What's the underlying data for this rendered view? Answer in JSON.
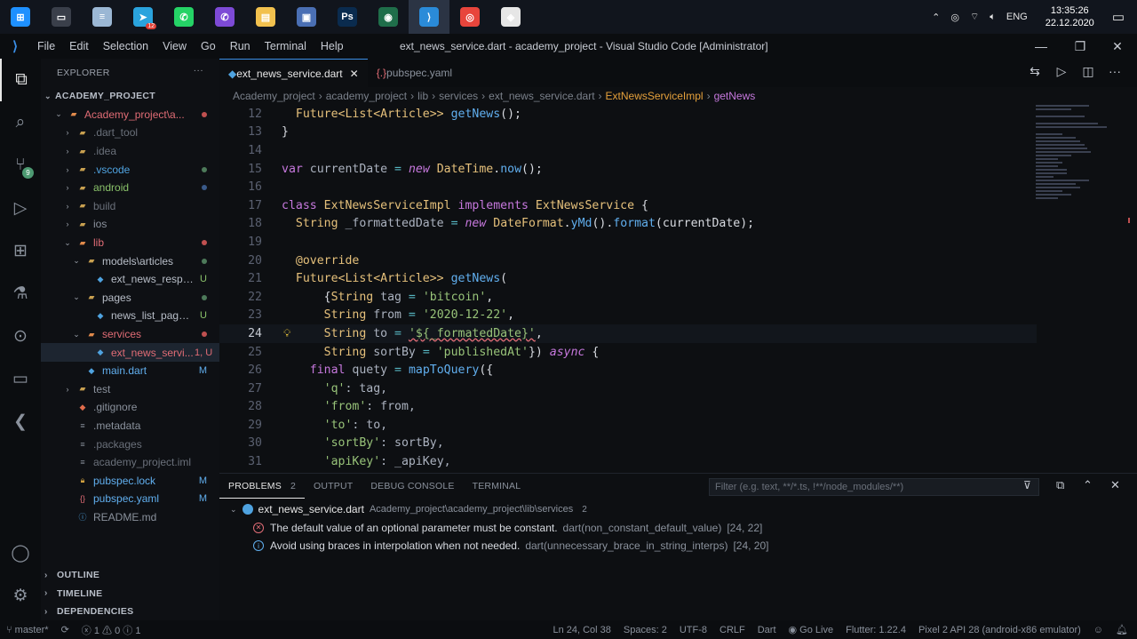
{
  "taskbar": {
    "apps": [
      {
        "name": "windows-start-icon",
        "color": "#1e90ff",
        "glyph": "⊞"
      },
      {
        "name": "task-view-icon",
        "color": "#3a3f4a",
        "glyph": "▭"
      },
      {
        "name": "notepad-icon",
        "color": "#9bb7d4",
        "glyph": "≡"
      },
      {
        "name": "telegram-icon",
        "color": "#2aa3dd",
        "glyph": "➤",
        "badge": "12"
      },
      {
        "name": "whatsapp-icon",
        "color": "#25d366",
        "glyph": "✆"
      },
      {
        "name": "viber-icon",
        "color": "#7d4ad6",
        "glyph": "✆"
      },
      {
        "name": "file-explorer-icon",
        "color": "#f2c14e",
        "glyph": "▤"
      },
      {
        "name": "save-icon",
        "color": "#4a6fb4",
        "glyph": "▣"
      },
      {
        "name": "photoshop-icon",
        "color": "#0a2b4e",
        "glyph": "Ps"
      },
      {
        "name": "android-studio-icon",
        "color": "#1f6e4a",
        "glyph": "◉"
      },
      {
        "name": "vscode-icon",
        "color": "#2a8bd9",
        "glyph": "⟩",
        "active": true
      },
      {
        "name": "chrome-icon",
        "color": "#e8453c",
        "glyph": "◎"
      },
      {
        "name": "app-icon",
        "color": "#e6e6e6",
        "glyph": "◈"
      }
    ],
    "tray": {
      "lang": "ENG",
      "time": "13:35:26",
      "date": "22.12.2020"
    }
  },
  "titlebar": {
    "menu": [
      "File",
      "Edit",
      "Selection",
      "View",
      "Go",
      "Run",
      "Terminal",
      "Help"
    ],
    "title": "ext_news_service.dart - academy_project - Visual Studio Code [Administrator]"
  },
  "activity": {
    "scm_badge": "9"
  },
  "explorer": {
    "title": "EXPLORER",
    "root": "ACADEMY_PROJECT",
    "tree": [
      {
        "indent": 1,
        "chev": "⌄",
        "label": "Academy_project\\a...",
        "icon": "folder",
        "color": "#e06c75",
        "deco": "dot",
        "decoColor": "#c05050"
      },
      {
        "indent": 2,
        "chev": "›",
        "label": ".dart_tool",
        "icon": "folder",
        "color": "#6a707a",
        "deco": "",
        "decoColor": ""
      },
      {
        "indent": 2,
        "chev": "›",
        "label": ".idea",
        "icon": "folder",
        "color": "#6a707a",
        "deco": "",
        "decoColor": ""
      },
      {
        "indent": 2,
        "chev": "›",
        "label": ".vscode",
        "icon": "folder",
        "color": "#4fa3e0",
        "deco": "dot",
        "decoColor": "#4d7a5a"
      },
      {
        "indent": 2,
        "chev": "›",
        "label": "android",
        "icon": "folder",
        "color": "#8ac26a",
        "deco": "dot",
        "decoColor": "#3a5a8a"
      },
      {
        "indent": 2,
        "chev": "›",
        "label": "build",
        "icon": "folder",
        "color": "#6a707a",
        "deco": "",
        "decoColor": ""
      },
      {
        "indent": 2,
        "chev": "›",
        "label": "ios",
        "icon": "folder",
        "color": "#8a919c",
        "deco": "",
        "decoColor": ""
      },
      {
        "indent": 2,
        "chev": "⌄",
        "label": "lib",
        "icon": "folder",
        "color": "#e06c75",
        "deco": "dot",
        "decoColor": "#c05050"
      },
      {
        "indent": 3,
        "chev": "⌄",
        "label": "models\\articles",
        "icon": "folder",
        "color": "#b8bec8",
        "deco": "dot",
        "decoColor": "#4d7a5a"
      },
      {
        "indent": 4,
        "chev": "",
        "label": "ext_news_respo...",
        "icon": "dart",
        "color": "#b8bec8",
        "deco": "U",
        "decoColor": "#8ac26a"
      },
      {
        "indent": 3,
        "chev": "⌄",
        "label": "pages",
        "icon": "folder",
        "color": "#b8bec8",
        "deco": "dot",
        "decoColor": "#4d7a5a"
      },
      {
        "indent": 4,
        "chev": "",
        "label": "news_list_page.d...",
        "icon": "dart",
        "color": "#b8bec8",
        "deco": "U",
        "decoColor": "#8ac26a"
      },
      {
        "indent": 3,
        "chev": "⌄",
        "label": "services",
        "icon": "folder",
        "color": "#e06c75",
        "deco": "dot",
        "decoColor": "#c05050"
      },
      {
        "indent": 4,
        "chev": "",
        "label": "ext_news_servi...",
        "icon": "dart",
        "color": "#e06c75",
        "deco": "1, U",
        "decoColor": "#e06c75",
        "selected": true
      },
      {
        "indent": 3,
        "chev": "",
        "label": "main.dart",
        "icon": "dart",
        "color": "#61afef",
        "deco": "M",
        "decoColor": "#61afef"
      },
      {
        "indent": 2,
        "chev": "›",
        "label": "test",
        "icon": "folder",
        "color": "#8a919c",
        "deco": "",
        "decoColor": ""
      },
      {
        "indent": 2,
        "chev": "",
        "label": ".gitignore",
        "icon": "git",
        "color": "#8a919c",
        "deco": "",
        "decoColor": ""
      },
      {
        "indent": 2,
        "chev": "",
        "label": ".metadata",
        "icon": "file",
        "color": "#8a919c",
        "deco": "",
        "decoColor": ""
      },
      {
        "indent": 2,
        "chev": "",
        "label": ".packages",
        "icon": "file",
        "color": "#6a707a",
        "deco": "",
        "decoColor": ""
      },
      {
        "indent": 2,
        "chev": "",
        "label": "academy_project.iml",
        "icon": "file",
        "color": "#6a707a",
        "deco": "",
        "decoColor": ""
      },
      {
        "indent": 2,
        "chev": "",
        "label": "pubspec.lock",
        "icon": "lock",
        "color": "#61afef",
        "deco": "M",
        "decoColor": "#61afef"
      },
      {
        "indent": 2,
        "chev": "",
        "label": "pubspec.yaml",
        "icon": "yaml",
        "color": "#61afef",
        "deco": "M",
        "decoColor": "#61afef"
      },
      {
        "indent": 2,
        "chev": "",
        "label": "README.md",
        "icon": "md",
        "color": "#8a919c",
        "deco": "",
        "decoColor": ""
      }
    ],
    "sections": [
      "OUTLINE",
      "TIMELINE",
      "DEPENDENCIES"
    ]
  },
  "tabs": [
    {
      "label": "ext_news_service.dart",
      "active": true,
      "icon": "dart"
    },
    {
      "label": "pubspec.yaml",
      "active": false,
      "icon": "yaml"
    }
  ],
  "breadcrumb": [
    "Academy_project",
    "academy_project",
    "lib",
    "services",
    "ext_news_service.dart",
    "ExtNewsServiceImpl",
    "getNews"
  ],
  "code": [
    {
      "n": "12",
      "t": [
        [
          "  ",
          "id"
        ],
        [
          "Future<List<Article>>",
          "ty"
        ],
        [
          " ",
          "id"
        ],
        [
          "getNews",
          "fn"
        ],
        [
          "();",
          "pm"
        ]
      ]
    },
    {
      "n": "13",
      "t": [
        [
          "}",
          "pm"
        ]
      ]
    },
    {
      "n": "14",
      "t": []
    },
    {
      "n": "15",
      "t": [
        [
          "var",
          "kw"
        ],
        [
          " currentDate ",
          "id"
        ],
        [
          "=",
          "op"
        ],
        [
          " ",
          "id"
        ],
        [
          "new",
          "kw it"
        ],
        [
          " ",
          "id"
        ],
        [
          "DateTime",
          "ty"
        ],
        [
          ".",
          "pm"
        ],
        [
          "now",
          "fn"
        ],
        [
          "();",
          "pm"
        ]
      ]
    },
    {
      "n": "16",
      "t": []
    },
    {
      "n": "17",
      "t": [
        [
          "class",
          "kw"
        ],
        [
          " ",
          "id"
        ],
        [
          "ExtNewsServiceImpl",
          "ty"
        ],
        [
          " ",
          "id"
        ],
        [
          "implements",
          "kw"
        ],
        [
          " ",
          "id"
        ],
        [
          "ExtNewsService",
          "ty"
        ],
        [
          " {",
          "pm"
        ]
      ]
    },
    {
      "n": "18",
      "t": [
        [
          "  ",
          "id"
        ],
        [
          "String",
          "ty"
        ],
        [
          " _formattedDate ",
          "id"
        ],
        [
          "=",
          "op"
        ],
        [
          " ",
          "id"
        ],
        [
          "new",
          "kw it"
        ],
        [
          " ",
          "id"
        ],
        [
          "DateFormat",
          "ty"
        ],
        [
          ".",
          "pm"
        ],
        [
          "yMd",
          "fn"
        ],
        [
          "().",
          "pm"
        ],
        [
          "format",
          "fn"
        ],
        [
          "(currentDate);",
          "pm"
        ]
      ]
    },
    {
      "n": "19",
      "t": []
    },
    {
      "n": "20",
      "t": [
        [
          "  ",
          "id"
        ],
        [
          "@override",
          "anno"
        ]
      ]
    },
    {
      "n": "21",
      "t": [
        [
          "  ",
          "id"
        ],
        [
          "Future<List<Article>>",
          "ty"
        ],
        [
          " ",
          "id"
        ],
        [
          "getNews",
          "fn"
        ],
        [
          "(",
          "pm"
        ]
      ]
    },
    {
      "n": "22",
      "t": [
        [
          "      {",
          "pm"
        ],
        [
          "String",
          "ty"
        ],
        [
          " tag ",
          "id"
        ],
        [
          "=",
          "op"
        ],
        [
          " ",
          "id"
        ],
        [
          "'bitcoin'",
          "st"
        ],
        [
          ",",
          "pm"
        ]
      ]
    },
    {
      "n": "23",
      "t": [
        [
          "      ",
          "id"
        ],
        [
          "String",
          "ty"
        ],
        [
          " from ",
          "id"
        ],
        [
          "=",
          "op"
        ],
        [
          " ",
          "id"
        ],
        [
          "'2020-12-22'",
          "st"
        ],
        [
          ",",
          "pm"
        ]
      ]
    },
    {
      "n": "24",
      "t": [
        [
          "      ",
          "id"
        ],
        [
          "String",
          "ty"
        ],
        [
          " to ",
          "id"
        ],
        [
          "=",
          "op"
        ],
        [
          " ",
          "id"
        ],
        [
          "'${_formatedDate}'",
          "st"
        ],
        [
          ",",
          "pm"
        ]
      ],
      "current": true,
      "bulb": true
    },
    {
      "n": "25",
      "t": [
        [
          "      ",
          "id"
        ],
        [
          "String",
          "ty"
        ],
        [
          " sortBy ",
          "id"
        ],
        [
          "=",
          "op"
        ],
        [
          " ",
          "id"
        ],
        [
          "'publishedAt'",
          "st"
        ],
        [
          "}) ",
          "pm"
        ],
        [
          "async",
          "kw it"
        ],
        [
          " {",
          "pm"
        ]
      ]
    },
    {
      "n": "26",
      "t": [
        [
          "    ",
          "id"
        ],
        [
          "final",
          "kw"
        ],
        [
          " quety ",
          "id"
        ],
        [
          "=",
          "op"
        ],
        [
          " ",
          "id"
        ],
        [
          "mapToQuery",
          "fn"
        ],
        [
          "({",
          "pm"
        ]
      ]
    },
    {
      "n": "27",
      "t": [
        [
          "      ",
          "id"
        ],
        [
          "'q'",
          "st"
        ],
        [
          ": tag,",
          "id"
        ]
      ]
    },
    {
      "n": "28",
      "t": [
        [
          "      ",
          "id"
        ],
        [
          "'from'",
          "st"
        ],
        [
          ": from,",
          "id"
        ]
      ]
    },
    {
      "n": "29",
      "t": [
        [
          "      ",
          "id"
        ],
        [
          "'to'",
          "st"
        ],
        [
          ": to,",
          "id"
        ]
      ]
    },
    {
      "n": "30",
      "t": [
        [
          "      ",
          "id"
        ],
        [
          "'sortBy'",
          "st"
        ],
        [
          ": sortBy,",
          "id"
        ]
      ]
    },
    {
      "n": "31",
      "t": [
        [
          "      ",
          "id"
        ],
        [
          "'apiKey'",
          "st"
        ],
        [
          ": _apiKey,",
          "id"
        ]
      ]
    }
  ],
  "panel": {
    "tabs": [
      "PROBLEMS",
      "OUTPUT",
      "DEBUG CONSOLE",
      "TERMINAL"
    ],
    "problems_count": "2",
    "filter_placeholder": "Filter (e.g. text, **/*.ts, !**/node_modules/**)",
    "file": {
      "name": "ext_news_service.dart",
      "path": "Academy_project\\academy_project\\lib\\services",
      "count": "2"
    },
    "problems": [
      {
        "type": "error",
        "msg": "The default value of an optional parameter must be constant.",
        "src": "dart(non_constant_default_value)",
        "pos": "[24, 22]"
      },
      {
        "type": "info",
        "msg": "Avoid using braces in interpolation when not needed.",
        "src": "dart(unnecessary_brace_in_string_interps)",
        "pos": "[24, 20]"
      }
    ]
  },
  "statusbar": {
    "branch": "master*",
    "errors": "1",
    "warnings": "0",
    "infos": "1",
    "position": "Ln 24, Col 38",
    "spaces": "Spaces: 2",
    "encoding": "UTF-8",
    "eol": "CRLF",
    "language": "Dart",
    "golive": "Go Live",
    "flutter": "Flutter: 1.22.4",
    "device": "Pixel 2 API 28 (android-x86 emulator)"
  }
}
